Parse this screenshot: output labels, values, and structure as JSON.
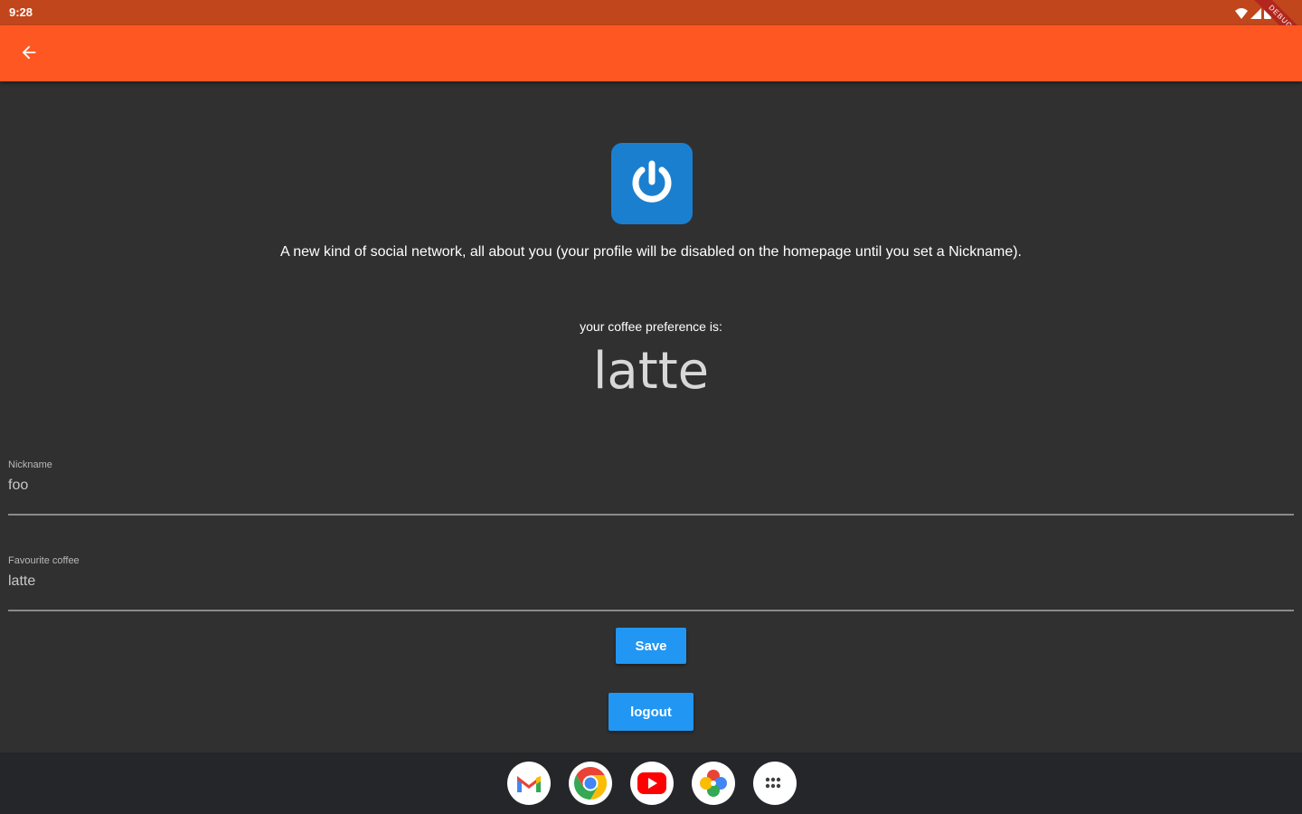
{
  "status_bar": {
    "time": "9:28",
    "debug_banner": "DEBUG",
    "icons": [
      "wifi-icon",
      "signal-icon",
      "battery-icon"
    ]
  },
  "app_bar": {
    "back_icon": "arrow-back-icon",
    "color": "#ff5722"
  },
  "main": {
    "logo_icon": "power-icon",
    "tagline": "A new kind of social network, all about you (your profile will be disabled on the homepage until you set a Nickname).",
    "preference_label": "your coffee preference is:",
    "preference_value": "latte"
  },
  "form": {
    "nickname": {
      "label": "Nickname",
      "value": "foo"
    },
    "favourite_coffee": {
      "label": "Favourite coffee",
      "value": "latte"
    },
    "save_label": "Save",
    "logout_label": "logout"
  },
  "taskbar": {
    "apps": [
      "gmail-icon",
      "chrome-icon",
      "youtube-icon",
      "google-photos-icon",
      "app-launcher-icon"
    ]
  },
  "colors": {
    "background": "#303030",
    "accent": "#2196f3",
    "status_bar": "#c2461b"
  }
}
